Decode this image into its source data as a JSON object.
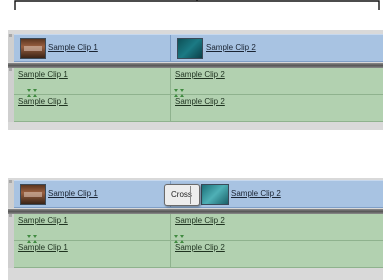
{
  "top": {
    "video_clips": [
      {
        "label": "Sample Clip 1"
      },
      {
        "label": "Sample Clip 2"
      }
    ],
    "audio_rows": [
      [
        "Sample Clip 1",
        "Sample Clip 2"
      ],
      [
        "Sample Clip 1",
        "Sample Clip 2"
      ]
    ]
  },
  "bottom": {
    "video_clips": [
      {
        "label": "Sample Clip 1"
      },
      {
        "label": "Sample Clip 2"
      }
    ],
    "transition": {
      "label": "Cross"
    },
    "audio_rows": [
      [
        "Sample Clip 1",
        "Sample Clip 2"
      ],
      [
        "Sample Clip 1",
        "Sample Clip 2"
      ]
    ]
  }
}
